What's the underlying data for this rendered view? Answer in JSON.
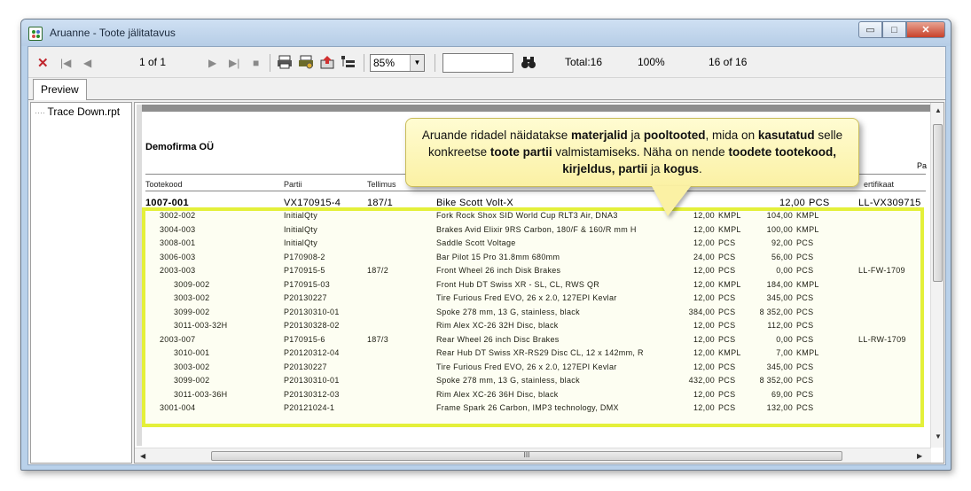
{
  "window": {
    "title": "Aruanne - Toote jälitatavus",
    "minimize": "▭",
    "maximize": "□",
    "close": "✕"
  },
  "toolbar": {
    "close_icon": "✕",
    "first_icon": "|◀",
    "prev_icon": "◀",
    "page_of": "1 of 1",
    "next_icon": "▶",
    "last_icon": "▶|",
    "stop_icon": "■",
    "zoom": "85%",
    "zoom_dropdown": "▼",
    "search_value": "",
    "total": "Total:16",
    "percent": "100%",
    "records": "16 of 16"
  },
  "tabs": {
    "preview": "Preview"
  },
  "tree": {
    "item": "Trace Down.rpt"
  },
  "report": {
    "company": "Demofirma OÜ",
    "right_partial": "Pa",
    "columns": {
      "code": "Tootekood",
      "batch": "Partii",
      "order": "Tellimus",
      "cert": "ertifikaat"
    },
    "main_row": {
      "code": "1007-001",
      "batch": "VX170915-4",
      "order": "187/1",
      "desc": "Bike Scott Volt-X",
      "qty": "12,00",
      "unit": "PCS",
      "cert": "LL-VX309715"
    },
    "rows": [
      {
        "code": "3002-002",
        "batch": "InitialQty",
        "order": "",
        "desc": "Fork Rock Shox SID World Cup RLT3 Air, DNA3",
        "qty": "12,00",
        "unit": "KMPL",
        "amount": "104,00",
        "unit2": "KMPL",
        "cert": ""
      },
      {
        "code": "3004-003",
        "batch": "InitialQty",
        "order": "",
        "desc": "Brakes Avid Elixir 9RS Carbon, 180/F & 160/R mm H",
        "qty": "12,00",
        "unit": "KMPL",
        "amount": "100,00",
        "unit2": "KMPL",
        "cert": ""
      },
      {
        "code": "3008-001",
        "batch": "InitialQty",
        "order": "",
        "desc": "Saddle Scott Voltage",
        "qty": "12,00",
        "unit": "PCS",
        "amount": "92,00",
        "unit2": "PCS",
        "cert": ""
      },
      {
        "code": "3006-003",
        "batch": "P170908-2",
        "order": "",
        "desc": "Bar Pilot 15 Pro 31.8mm 680mm",
        "qty": "24,00",
        "unit": "PCS",
        "amount": "56,00",
        "unit2": "PCS",
        "cert": ""
      },
      {
        "code": "2003-003",
        "batch": "P170915-5",
        "order": "187/2",
        "desc": "Front Wheel 26 inch Disk Brakes",
        "qty": "12,00",
        "unit": "PCS",
        "amount": "0,00",
        "unit2": "PCS",
        "cert": "LL-FW-1709"
      },
      {
        "code": "3009-002",
        "batch": "P170915-03",
        "order": "",
        "desc": "Front Hub DT Swiss XR - SL, CL, RWS QR",
        "qty": "12,00",
        "unit": "KMPL",
        "amount": "184,00",
        "unit2": "KMPL",
        "cert": ""
      },
      {
        "code": "3003-002",
        "batch": "P20130227",
        "order": "",
        "desc": "Tire Furious Fred EVO, 26 x 2.0, 127EPI Kevlar",
        "qty": "12,00",
        "unit": "PCS",
        "amount": "345,00",
        "unit2": "PCS",
        "cert": ""
      },
      {
        "code": "3099-002",
        "batch": "P20130310-01",
        "order": "",
        "desc": "Spoke 278 mm, 13 G, stainless, black",
        "qty": "384,00",
        "unit": "PCS",
        "amount": "8 352,00",
        "unit2": "PCS",
        "cert": ""
      },
      {
        "code": "3011-003-32H",
        "batch": "P20130328-02",
        "order": "",
        "desc": "Rim Alex XC-26 32H Disc, black",
        "qty": "12,00",
        "unit": "PCS",
        "amount": "112,00",
        "unit2": "PCS",
        "cert": ""
      },
      {
        "code": "2003-007",
        "batch": "P170915-6",
        "order": "187/3",
        "desc": "Rear Wheel 26 inch Disc Brakes",
        "qty": "12,00",
        "unit": "PCS",
        "amount": "0,00",
        "unit2": "PCS",
        "cert": "LL-RW-1709"
      },
      {
        "code": "3010-001",
        "batch": "P20120312-04",
        "order": "",
        "desc": "Rear Hub DT Swiss XR-RS29 Disc CL, 12 x 142mm, R",
        "qty": "12,00",
        "unit": "KMPL",
        "amount": "7,00",
        "unit2": "KMPL",
        "cert": ""
      },
      {
        "code": "3003-002",
        "batch": "P20130227",
        "order": "",
        "desc": "Tire Furious Fred EVO, 26 x 2.0, 127EPI Kevlar",
        "qty": "12,00",
        "unit": "PCS",
        "amount": "345,00",
        "unit2": "PCS",
        "cert": ""
      },
      {
        "code": "3099-002",
        "batch": "P20130310-01",
        "order": "",
        "desc": "Spoke 278 mm, 13 G, stainless, black",
        "qty": "432,00",
        "unit": "PCS",
        "amount": "8 352,00",
        "unit2": "PCS",
        "cert": ""
      },
      {
        "code": "3011-003-36H",
        "batch": "P20130312-03",
        "order": "",
        "desc": "Rim Alex XC-26 36H Disc, black",
        "qty": "12,00",
        "unit": "PCS",
        "amount": "69,00",
        "unit2": "PCS",
        "cert": ""
      },
      {
        "code": "3001-004",
        "batch": "P20121024-1",
        "order": "",
        "desc": "Frame Spark 26 Carbon, IMP3 technology, DMX",
        "qty": "12,00",
        "unit": "PCS",
        "amount": "132,00",
        "unit2": "PCS",
        "cert": ""
      }
    ],
    "indent_levels": [
      1,
      1,
      1,
      1,
      1,
      2,
      2,
      2,
      2,
      1,
      2,
      2,
      2,
      2,
      1
    ]
  },
  "callout": {
    "p1": "Aruande ridadel näidatakse ",
    "b1": "materjalid",
    "p2": " ja ",
    "b2": "pooltooted",
    "p3": ", mida on ",
    "b3": "kasutatud",
    "p4": " selle konkreetse ",
    "b4": "toote partii",
    "p5": " valmistamiseks. Näha on nende ",
    "b5": "toodete tootekood, kirjeldus, partii",
    "p6": " ja ",
    "b6": "kogus",
    "p7": "."
  },
  "scroll": {
    "grip": "III"
  },
  "colors": {
    "highlight": "#e4f03a",
    "callout_bg": "#fbf1a4",
    "close_red": "#c0262e"
  }
}
